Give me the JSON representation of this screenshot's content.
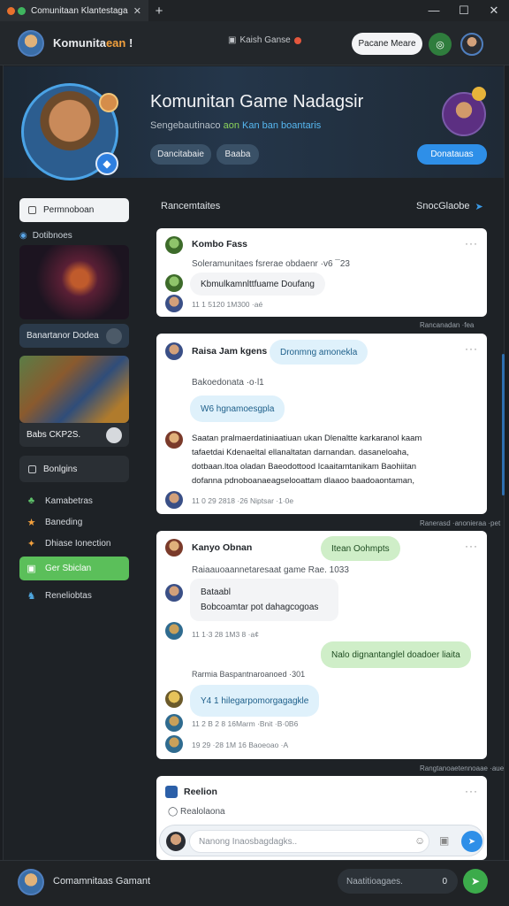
{
  "browser": {
    "tab_title": "Comunitaan Klantestagan",
    "tab_close": "✕",
    "new_tab": "+",
    "min": "—",
    "max": "☐",
    "close": "✕"
  },
  "appbar": {
    "title_main": "Komunita",
    "title_accent": "ean",
    "title_suffix": "!",
    "center_label": "Kaish Ganse",
    "action_button": "Pacane Meare"
  },
  "hero": {
    "title": "Komunitan Game Nadagsir",
    "subtitle_plain": "Sengebautinaco",
    "subtitle_green": "aon",
    "subtitle_blue": "Kan ban boantaris",
    "pill_a": "Dancitabaie",
    "pill_b": "Baaba",
    "primary_button": "Donatauas"
  },
  "sidebar": {
    "top_button": "Permnoboan",
    "section_label": "Dotibnoes",
    "card1_caption": "Banartanor Dodea",
    "card2_caption": "Babs CKP2S.",
    "section_button": "Bonlgins",
    "nav": [
      {
        "label": "Kamabetras",
        "icon": "♣"
      },
      {
        "label": "Baneding",
        "icon": "★"
      },
      {
        "label": "Dhiase Ionection",
        "icon": "✦"
      },
      {
        "label": "Ger Sbiclan",
        "icon": "▣"
      },
      {
        "label": "Reneliobtas",
        "icon": "♞"
      }
    ]
  },
  "main": {
    "heading_left": "Rancemtaites",
    "heading_right": "SnocGlaobe",
    "posts": [
      {
        "name": "Kombo Fass",
        "line1": "Soleramunitaes fsrerae obdaenr ·v6 ¯23",
        "bubble": "Kbmulkamnlttfuame Doufang",
        "meta": "11 1 5120 1M300 ·aé"
      },
      {
        "name": "Raisa Jam kgens",
        "tag": "Dronmng amonekla",
        "line1": "Bakoedonata ·o·l1",
        "bubble": "W6 hgnamoesgpla",
        "long": [
          "Saatan pralmaerdatiniaatiuan ukan Dlenaltte karkaranol kaam",
          "tafaetdai Kdenaeltal ellanaltatan darnandan. dasaneloaha,",
          "dotbaan.ltoa oladan Baeodottood Icaaitamtanikam Baohiitan",
          "dofanna pdnoboanaeagselooattam dlaaoo baadoaontaman,"
        ],
        "meta": "11 0 29 2818 ·26 Niptsar ·1·0e",
        "after": "Ranerasd ·anonieraa ·pet"
      },
      {
        "name": "Kanyo Obnan",
        "tag": "Itean Oohmpts",
        "line1": "Raiaauoaannetaresaat game  Rae. 1033",
        "grey1": "Bataabl",
        "grey2": "Bobcoamtar pot dahagcogoas",
        "meta1": "11 1·3 28 1M3 8 ·a¢",
        "green": "Nalo dignantanglel doadoer liaita",
        "line2": "Rarmia Baspantnaroanoed ·301",
        "bubble": "Y4 1 hilegarpomorgagagkle",
        "meta2": "11 2 B 2 8 16Marm ·Bnit ·B·0B6",
        "meta3": "19 29 ·28 1M 16 Baoeoao ·A",
        "after": "Rangtanoaetennoaae  ·aue"
      },
      {
        "name": "Reelion",
        "sub": "Realolaona"
      }
    ],
    "between_1": "Rancanadan ·fea"
  },
  "composer": {
    "placeholder": "Nanong Inaosbagdagks.."
  },
  "footer": {
    "title": "Comamnitaas Gamant",
    "input_placeholder": "Naatitioagaes.",
    "input_mark": "0"
  }
}
